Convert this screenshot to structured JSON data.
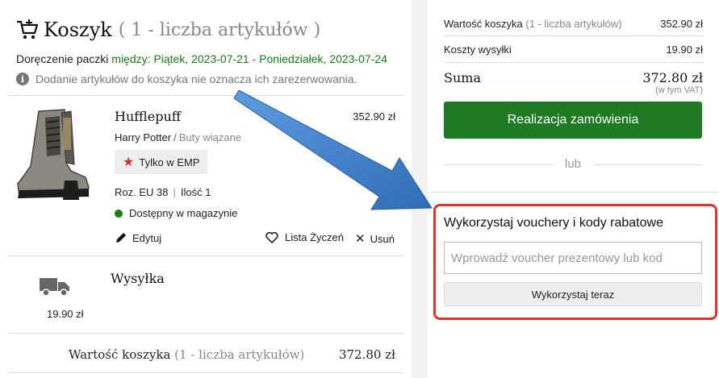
{
  "cart": {
    "title": "Koszyk",
    "count_label": "( 1 - liczba artykułów )",
    "delivery_prefix": "Doręczenie paczki ",
    "delivery_dates": "między: Piątek, 2023-07-21 - Poniedziałek, 2023-07-24",
    "notice": "Dodanie artykułów do koszyka nie oznacza ich zarezerwowania."
  },
  "item": {
    "name": "Hufflepuff",
    "price": "352.90 zł",
    "brand": "Harry Potter",
    "separator": "/",
    "type": "Buty wiązane",
    "badge": "Tylko w EMP",
    "size": "Roz. EU 38",
    "quantity": "Ilość 1",
    "stock": "Dostępny w magazynie",
    "edit_label": "Edytuj",
    "wishlist_label": "Lista Życzeń",
    "remove_label": "Usuń"
  },
  "shipping": {
    "label": "Wysyłka",
    "price": "19.90 zł"
  },
  "left_total": {
    "label": "Wartość koszyka",
    "count": "(1 - liczba artykułów)",
    "value": "372.80 zł"
  },
  "summary": {
    "cart_value_label": "Wartość koszyka",
    "cart_value_count": "(1 - liczba artykułów)",
    "cart_value": "352.90 zł",
    "shipping_label": "Koszty wysyłki",
    "shipping_value": "19.90 zł",
    "sum_label": "Suma",
    "sum_value": "372.80 zł",
    "vat_note": "(w tym VAT)",
    "checkout_label": "Realizacja zamówienia",
    "or_label": "lub"
  },
  "voucher": {
    "title": "Wykorzystaj vouchery i kody rabatowe",
    "placeholder": "Wprowadź voucher prezentowy lub kod",
    "button_label": "Wykorzystaj teraz"
  },
  "colors": {
    "accent_green": "#1e7a24",
    "highlight_red": "#e0342a",
    "arrow_blue": "#3f7fc7"
  }
}
